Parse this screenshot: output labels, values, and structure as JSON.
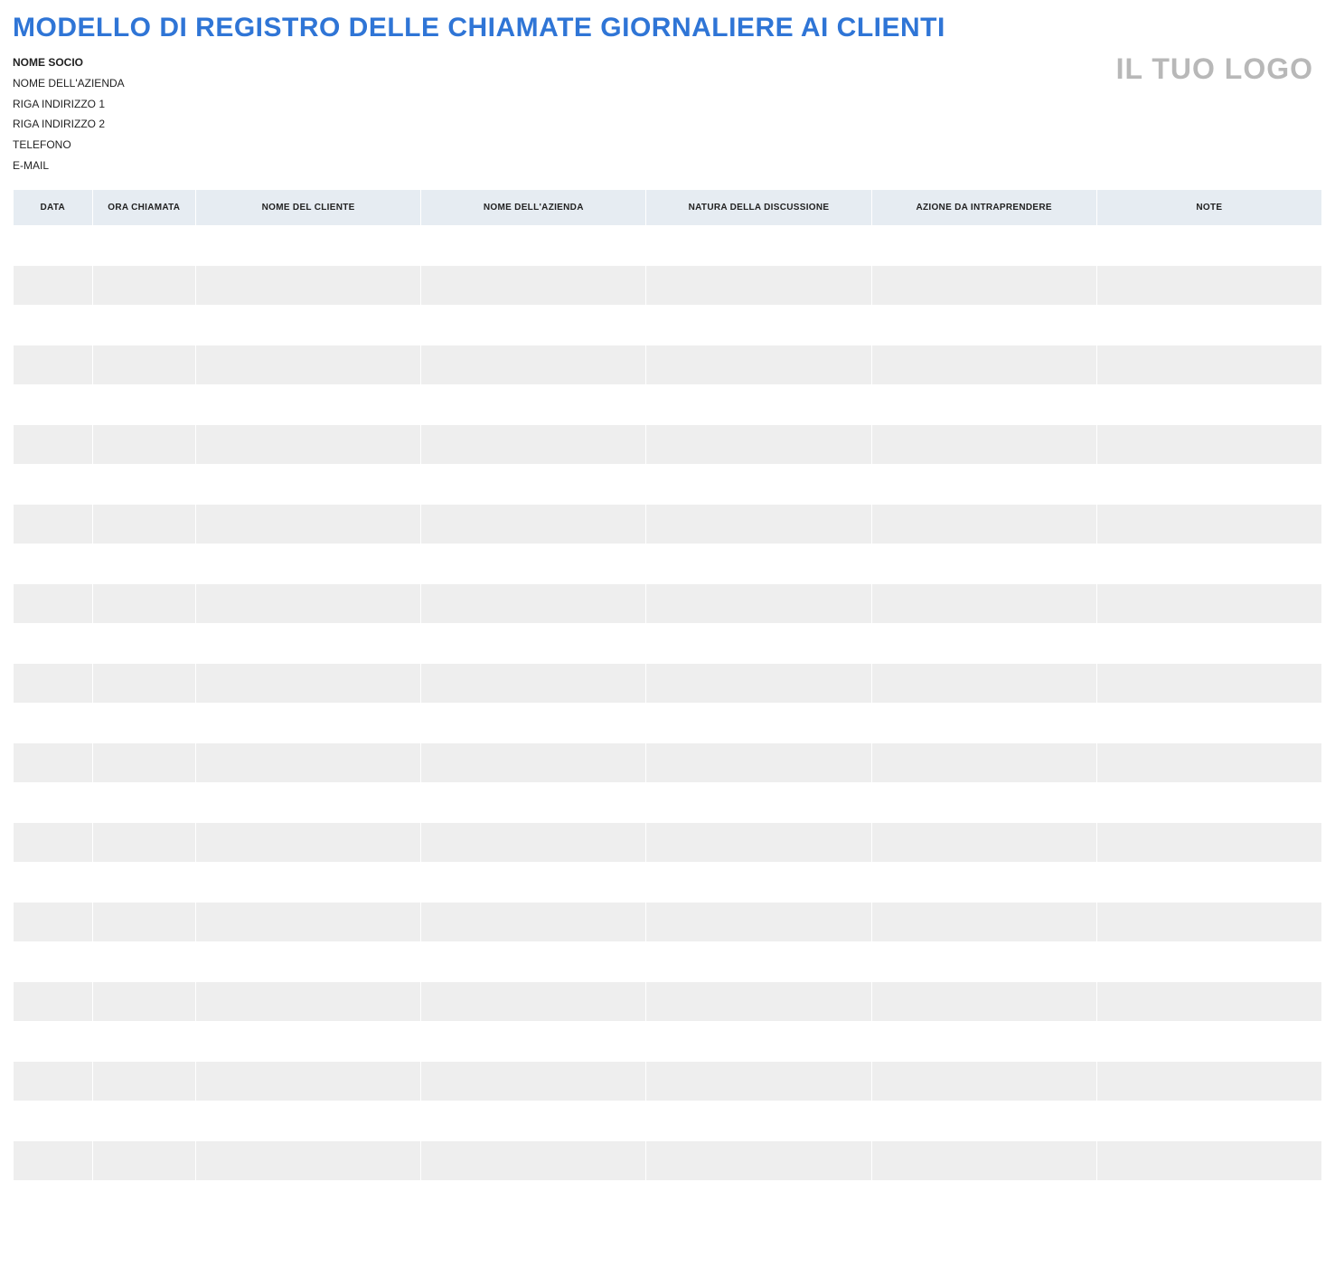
{
  "title": "MODELLO DI REGISTRO DELLE CHIAMATE GIORNALIERE AI CLIENTI",
  "logo_placeholder": "IL TUO LOGO",
  "info": {
    "partner_label": "NOME SOCIO",
    "company_label": "NOME DELL'AZIENDA",
    "address1_label": "RIGA INDIRIZZO 1",
    "address2_label": "RIGA INDIRIZZO 2",
    "phone_label": "TELEFONO",
    "email_label": "E-MAIL"
  },
  "table": {
    "headers": {
      "data": "DATA",
      "ora": "ORA CHIAMATA",
      "cliente": "NOME DEL CLIENTE",
      "azienda": "NOME DELL'AZIENDA",
      "natura": "NATURA DELLA DISCUSSIONE",
      "azione": "AZIONE DA INTRAPRENDERE",
      "note": "NOTE"
    },
    "rows": [
      {
        "data": "",
        "ora": "",
        "cliente": "",
        "azienda": "",
        "natura": "",
        "azione": "",
        "note": ""
      },
      {
        "data": "",
        "ora": "",
        "cliente": "",
        "azienda": "",
        "natura": "",
        "azione": "",
        "note": ""
      },
      {
        "data": "",
        "ora": "",
        "cliente": "",
        "azienda": "",
        "natura": "",
        "azione": "",
        "note": ""
      },
      {
        "data": "",
        "ora": "",
        "cliente": "",
        "azienda": "",
        "natura": "",
        "azione": "",
        "note": ""
      },
      {
        "data": "",
        "ora": "",
        "cliente": "",
        "azienda": "",
        "natura": "",
        "azione": "",
        "note": ""
      },
      {
        "data": "",
        "ora": "",
        "cliente": "",
        "azienda": "",
        "natura": "",
        "azione": "",
        "note": ""
      },
      {
        "data": "",
        "ora": "",
        "cliente": "",
        "azienda": "",
        "natura": "",
        "azione": "",
        "note": ""
      },
      {
        "data": "",
        "ora": "",
        "cliente": "",
        "azienda": "",
        "natura": "",
        "azione": "",
        "note": ""
      },
      {
        "data": "",
        "ora": "",
        "cliente": "",
        "azienda": "",
        "natura": "",
        "azione": "",
        "note": ""
      },
      {
        "data": "",
        "ora": "",
        "cliente": "",
        "azienda": "",
        "natura": "",
        "azione": "",
        "note": ""
      },
      {
        "data": "",
        "ora": "",
        "cliente": "",
        "azienda": "",
        "natura": "",
        "azione": "",
        "note": ""
      },
      {
        "data": "",
        "ora": "",
        "cliente": "",
        "azienda": "",
        "natura": "",
        "azione": "",
        "note": ""
      },
      {
        "data": "",
        "ora": "",
        "cliente": "",
        "azienda": "",
        "natura": "",
        "azione": "",
        "note": ""
      },
      {
        "data": "",
        "ora": "",
        "cliente": "",
        "azienda": "",
        "natura": "",
        "azione": "",
        "note": ""
      },
      {
        "data": "",
        "ora": "",
        "cliente": "",
        "azienda": "",
        "natura": "",
        "azione": "",
        "note": ""
      },
      {
        "data": "",
        "ora": "",
        "cliente": "",
        "azienda": "",
        "natura": "",
        "azione": "",
        "note": ""
      },
      {
        "data": "",
        "ora": "",
        "cliente": "",
        "azienda": "",
        "natura": "",
        "azione": "",
        "note": ""
      },
      {
        "data": "",
        "ora": "",
        "cliente": "",
        "azienda": "",
        "natura": "",
        "azione": "",
        "note": ""
      },
      {
        "data": "",
        "ora": "",
        "cliente": "",
        "azienda": "",
        "natura": "",
        "azione": "",
        "note": ""
      },
      {
        "data": "",
        "ora": "",
        "cliente": "",
        "azienda": "",
        "natura": "",
        "azione": "",
        "note": ""
      },
      {
        "data": "",
        "ora": "",
        "cliente": "",
        "azienda": "",
        "natura": "",
        "azione": "",
        "note": ""
      },
      {
        "data": "",
        "ora": "",
        "cliente": "",
        "azienda": "",
        "natura": "",
        "azione": "",
        "note": ""
      },
      {
        "data": "",
        "ora": "",
        "cliente": "",
        "azienda": "",
        "natura": "",
        "azione": "",
        "note": ""
      },
      {
        "data": "",
        "ora": "",
        "cliente": "",
        "azienda": "",
        "natura": "",
        "azione": "",
        "note": ""
      },
      {
        "data": "",
        "ora": "",
        "cliente": "",
        "azienda": "",
        "natura": "",
        "azione": "",
        "note": ""
      }
    ]
  }
}
